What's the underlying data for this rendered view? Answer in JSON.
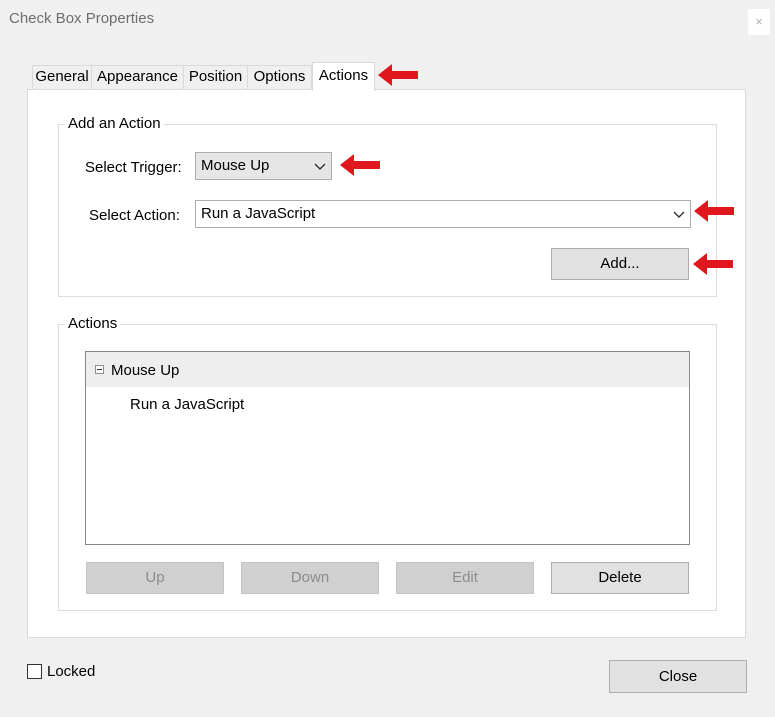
{
  "window": {
    "title": "Check Box Properties",
    "close_glyph": "×"
  },
  "tabs": [
    {
      "label": "General"
    },
    {
      "label": "Appearance"
    },
    {
      "label": "Position"
    },
    {
      "label": "Options"
    },
    {
      "label": "Actions",
      "active": true
    }
  ],
  "add_action": {
    "group_title": "Add an Action",
    "trigger_label": "Select Trigger:",
    "trigger_value": "Mouse Up",
    "action_label": "Select Action:",
    "action_value": "Run a JavaScript",
    "add_button": "Add..."
  },
  "actions": {
    "group_title": "Actions",
    "tree": {
      "trigger": "Mouse Up",
      "action": "Run a JavaScript"
    },
    "buttons": {
      "up": "Up",
      "down": "Down",
      "edit": "Edit",
      "delete": "Delete"
    }
  },
  "footer": {
    "locked_label": "Locked",
    "locked_checked": false,
    "close_button": "Close"
  },
  "colors": {
    "arrow": "#e0171c",
    "dialog_bg": "#f0f0f0",
    "panel_bg": "#ffffff"
  },
  "icons": [
    "close-icon",
    "chevron-down-icon",
    "collapse-icon",
    "arrow-pointer-icon"
  ]
}
